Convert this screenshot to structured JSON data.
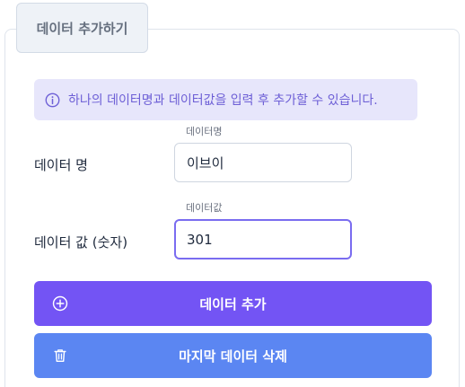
{
  "tab": {
    "label": "데이터 추가하기"
  },
  "info": {
    "message": "하나의 데이터명과 데이터값을 입력 후 추가할 수 있습니다."
  },
  "name_field": {
    "label": "데이터 명",
    "floating_label": "데이터명",
    "value": "이브이"
  },
  "value_field": {
    "label": "데이터 값 (숫자)",
    "floating_label": "데이터값",
    "value": "301"
  },
  "buttons": {
    "add_label": "데이터 추가",
    "delete_label": "마지막 데이터 삭제"
  },
  "icons": {
    "info": "info-icon",
    "add": "plus-circle-icon",
    "delete": "trash-icon"
  },
  "colors": {
    "add_button": "#7354f4",
    "delete_button": "#5b86f2",
    "info_bg": "#e7e6fb",
    "info_text": "#6d5fd6",
    "focus_border": "#7a6cf0"
  }
}
